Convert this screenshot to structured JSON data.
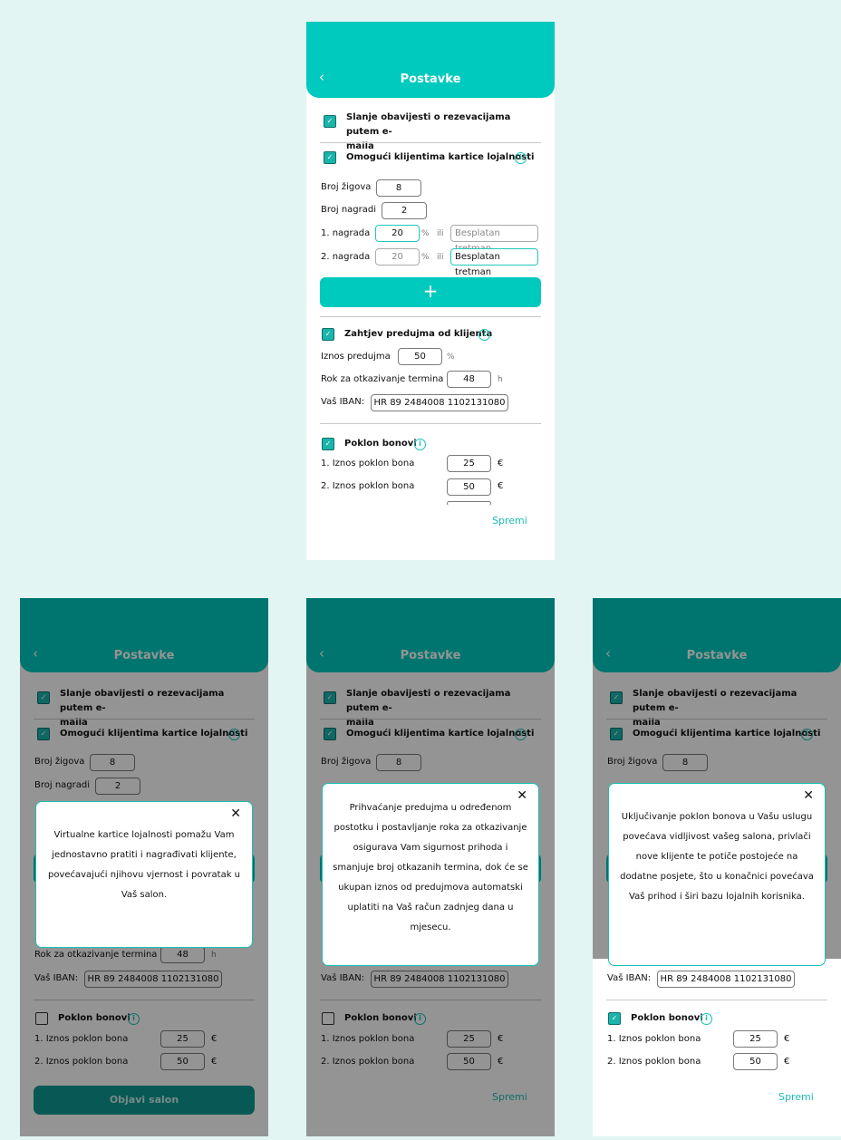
{
  "header": {
    "back": "‹",
    "title": "Postavke"
  },
  "email": {
    "label": "Slanje obavijesti o rezevacijama putem e-",
    "label2": "maila"
  },
  "loyalty": {
    "label": "Omogući klijentima kartice lojalnosti",
    "stamps_label": "Broj žigova",
    "stamps_value": "8",
    "rewards_label": "Broj nagradi",
    "rewards_value": "2",
    "reward1_label": "1. nagrada",
    "reward1_percent": "20",
    "reward2_label": "2. nagrada",
    "reward2_percent": "20",
    "percent_sym": "%",
    "or_text": "ili",
    "free_treatment": "Besplatan tretman",
    "add": "+"
  },
  "deposit": {
    "label": "Zahtjev predujma od klijenta",
    "amount_label": "Iznos predujma",
    "amount_value": "50",
    "amount_unit": "%",
    "cancel_label": "Rok za otkazivanje termina",
    "cancel_value": "48",
    "cancel_unit": "h",
    "iban_label": "Vaš IBAN:",
    "iban_value": "HR 89 2484008 1102131080"
  },
  "vouchers": {
    "label": "Poklon bonovi",
    "v1_label": "1. Iznos poklon bona",
    "v1_value": "25",
    "v2_label": "2. Iznos poklon bona",
    "v2_value": "50",
    "currency": "€"
  },
  "save_label": "Spremi",
  "publish_label": "Objavi salon",
  "info_glyph": "i",
  "close_glyph": "✕",
  "check_glyph": "✓",
  "modals": {
    "loyalty": "Virtualne kartice lojalnosti pomažu Vam jednostavno pratiti i nagrađivati klijente, povećavajući njihovu vjernost i povratak u Vaš salon.",
    "deposit": "Prihvaćanje predujma u određenom postotku i postavljanje roka za otkazivanje osigurava Vam sigurnost prihoda i smanjuje broj otkazanih termina, dok će se ukupan iznos od predujmova automatski uplatiti na Vaš račun zadnjeg dana u mjesecu.",
    "vouchers": "Uključivanje poklon bonova u Vašu uslugu povećava vidljivost vašeg salona, privlači nove klijente te potiče postojeće na dodatne posjete, što u konačnici povećava Vaš prihod i širi bazu lojalnih korisnika."
  },
  "colors": {
    "accent": "#00c9bd",
    "background": "#e2f5f3",
    "publish": "#0c9a92"
  }
}
